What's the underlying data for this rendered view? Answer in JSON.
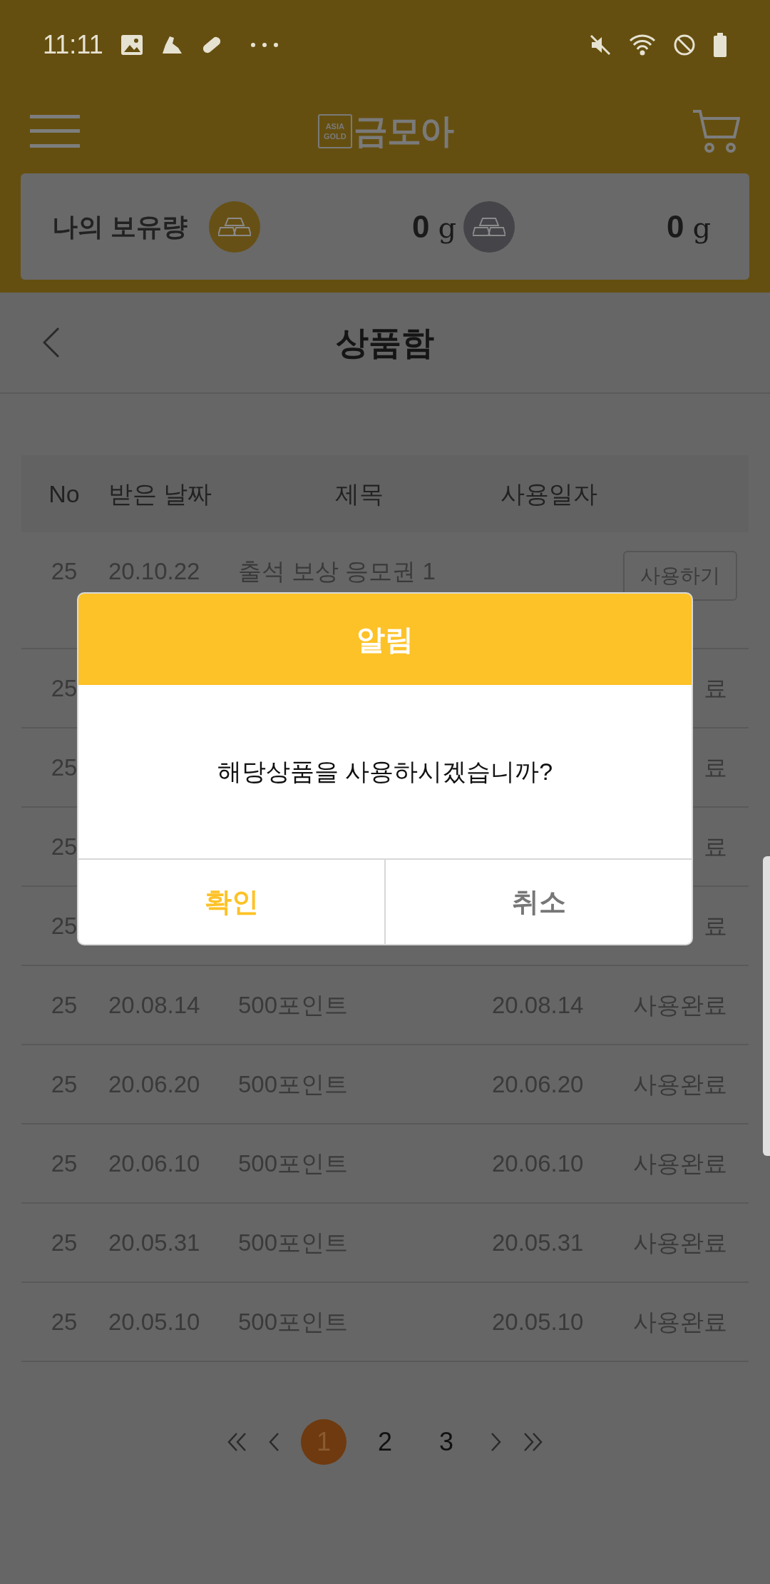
{
  "status_bar": {
    "time": "11:11"
  },
  "header": {
    "logo": {
      "badge_lines": [
        "ASIA",
        "GOLD"
      ],
      "text": "금모아"
    }
  },
  "holdings": {
    "label": "나의 보유량",
    "items": [
      {
        "kind": "gold",
        "amount": "0",
        "unit": "g"
      },
      {
        "kind": "silver",
        "amount": "0",
        "unit": "g"
      }
    ]
  },
  "page": {
    "title": "상품함"
  },
  "table": {
    "columns": [
      "No",
      "받은 날짜",
      "제목",
      "사용일자"
    ],
    "rows": [
      {
        "kind": "action",
        "no": "25",
        "received": "20.10.22",
        "title": "출석 보상 응모권 1",
        "button": "사용하기"
      },
      {
        "kind": "covered",
        "no": "25",
        "status": "료"
      },
      {
        "kind": "covered",
        "no": "25",
        "status": "료"
      },
      {
        "kind": "covered",
        "no": "25",
        "status": "료"
      },
      {
        "kind": "covered",
        "no": "25",
        "status": "료"
      },
      {
        "kind": "used",
        "no": "25",
        "received": "20.08.14",
        "title": "500포인트",
        "used_date": "20.08.14",
        "status": "사용완료"
      },
      {
        "kind": "used",
        "no": "25",
        "received": "20.06.20",
        "title": "500포인트",
        "used_date": "20.06.20",
        "status": "사용완료"
      },
      {
        "kind": "used",
        "no": "25",
        "received": "20.06.10",
        "title": "500포인트",
        "used_date": "20.06.10",
        "status": "사용완료"
      },
      {
        "kind": "used",
        "no": "25",
        "received": "20.05.31",
        "title": "500포인트",
        "used_date": "20.05.31",
        "status": "사용완료"
      },
      {
        "kind": "used",
        "no": "25",
        "received": "20.05.10",
        "title": "500포인트",
        "used_date": "20.05.10",
        "status": "사용완료"
      }
    ]
  },
  "pagination": {
    "pages": [
      {
        "label": "1",
        "selected": true
      },
      {
        "label": "2",
        "selected": false
      },
      {
        "label": "3",
        "selected": false
      }
    ]
  },
  "dialog": {
    "title": "알림",
    "message": "해당상품을 사용하시겠습니까?",
    "buttons": [
      {
        "label": "확인",
        "kind": "confirm"
      },
      {
        "label": "취소",
        "kind": "cancel"
      }
    ]
  }
}
